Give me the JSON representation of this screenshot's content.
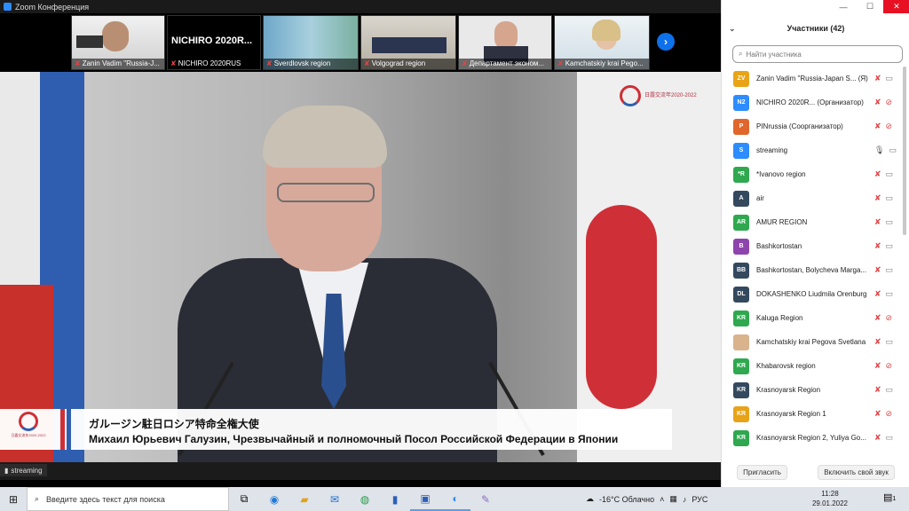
{
  "window": {
    "title": "Zoom Конференция"
  },
  "thumbnails": [
    {
      "name": "Zanin Vadim \"Russia-J...",
      "muted": true
    },
    {
      "name": "NICHIRO 2020RUS",
      "muted": true,
      "big_label": "NICHIRO 2020R..."
    },
    {
      "name": "Sverdlovsk region",
      "muted": true
    },
    {
      "name": "Volgograd region",
      "muted": true
    },
    {
      "name": "Департамент эконом...",
      "muted": true
    },
    {
      "name": "Kamchatskiy krai Pego...",
      "muted": true
    }
  ],
  "main_video": {
    "caption_jp": "ガルージン駐日ロシア特命全権大使",
    "caption_ru": "Михаил Юрьевич Галузин, Чрезвычайный и полномочный Посол Российской Федерации в Японии",
    "logo_text": "日露交流年2020-2022",
    "active_speaker_tag": "streaming"
  },
  "panel": {
    "title": "Участники (42)",
    "search_placeholder": "Найти участника",
    "invite_label": "Пригласить",
    "unmute_label": "Включить свой звук",
    "participants": [
      {
        "initials": "ZV",
        "name": "Zanin Vadim \"Russia-Japan S... (Я)",
        "color": "#e8a317",
        "mic": "off",
        "cam": "on"
      },
      {
        "initials": "N2",
        "name": "NICHIRO 2020R... (Организатор)",
        "color": "#2d8cff",
        "mic": "off",
        "cam": "off"
      },
      {
        "initials": "P",
        "name": "PINrussia (Соорганизатор)",
        "color": "#e0662b",
        "mic": "off",
        "cam": "off"
      },
      {
        "initials": "S",
        "name": "streaming",
        "color": "#2d8cff",
        "mic": "on",
        "cam": "on"
      },
      {
        "initials": "*R",
        "name": "*Ivanovo region",
        "color": "#2fa84f",
        "mic": "off",
        "cam": "on"
      },
      {
        "initials": "A",
        "name": "air",
        "color": "#34495e",
        "mic": "off",
        "cam": "on"
      },
      {
        "initials": "AR",
        "name": "AMUR REGION",
        "color": "#2fa84f",
        "mic": "off",
        "cam": "on"
      },
      {
        "initials": "B",
        "name": "Bashkortostan",
        "color": "#8e44ad",
        "mic": "off",
        "cam": "on"
      },
      {
        "initials": "BB",
        "name": "Bashkortostan, Bolycheva Marga...",
        "color": "#34495e",
        "mic": "off",
        "cam": "on"
      },
      {
        "initials": "DL",
        "name": "DOKASHENKO Liudmila Orenburg",
        "color": "#34495e",
        "mic": "off",
        "cam": "on"
      },
      {
        "initials": "KR",
        "name": "Kaluga Region",
        "color": "#2fa84f",
        "mic": "off",
        "cam": "off"
      },
      {
        "initials": "",
        "name": "Kamchatskiy krai Pegova Svetlana",
        "color": "#d9b38c",
        "mic": "off",
        "cam": "on"
      },
      {
        "initials": "KR",
        "name": "Khabarovsk region",
        "color": "#2fa84f",
        "mic": "off",
        "cam": "off"
      },
      {
        "initials": "KR",
        "name": "Krasnoyarsk Region",
        "color": "#34495e",
        "mic": "off",
        "cam": "on"
      },
      {
        "initials": "KR",
        "name": "Krasnoyarsk Region 1",
        "color": "#e8a317",
        "mic": "off",
        "cam": "off"
      },
      {
        "initials": "KR",
        "name": "Krasnoyarsk Region 2, Yuliya Go...",
        "color": "#2fa84f",
        "mic": "off",
        "cam": "on"
      }
    ]
  },
  "taskbar": {
    "search_placeholder": "Введите здесь текст для поиска",
    "weather": "-16°C Облачно",
    "lang": "РУС",
    "time": "11:28",
    "date": "29.01.2022",
    "notifications": "1"
  }
}
